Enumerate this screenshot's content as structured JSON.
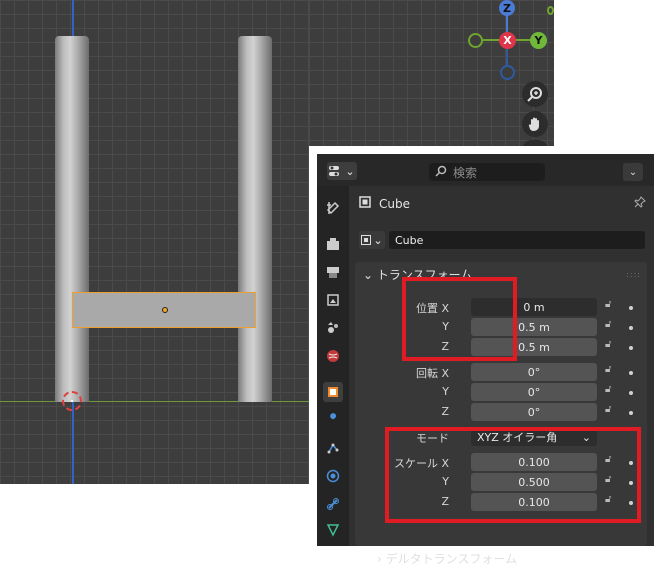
{
  "panel": {
    "search_placeholder": "検索",
    "object_title": "Cube",
    "object_name_field": "Cube",
    "section_title": "トランスフォーム",
    "location": {
      "label_x": "位置 X",
      "label_y": "Y",
      "label_z": "Z",
      "x": "0 m",
      "y": "0.5 m",
      "z": "0.5 m"
    },
    "rotation": {
      "label_x": "回転 X",
      "label_y": "Y",
      "label_z": "Z",
      "x": "0°",
      "y": "0°",
      "z": "0°"
    },
    "mode": {
      "label": "モード",
      "value": "XYZ オイラー角"
    },
    "scale": {
      "label_x": "スケール X",
      "label_y": "Y",
      "label_z": "Z",
      "x": "0.100",
      "y": "0.500",
      "z": "0.100"
    },
    "delta_section": "デルタトランスフォーム"
  },
  "gizmo": {
    "z": "Z",
    "x": "X",
    "y": "Y"
  },
  "colors": {
    "highlight": "#e01b24",
    "selection": "#f0a030"
  }
}
